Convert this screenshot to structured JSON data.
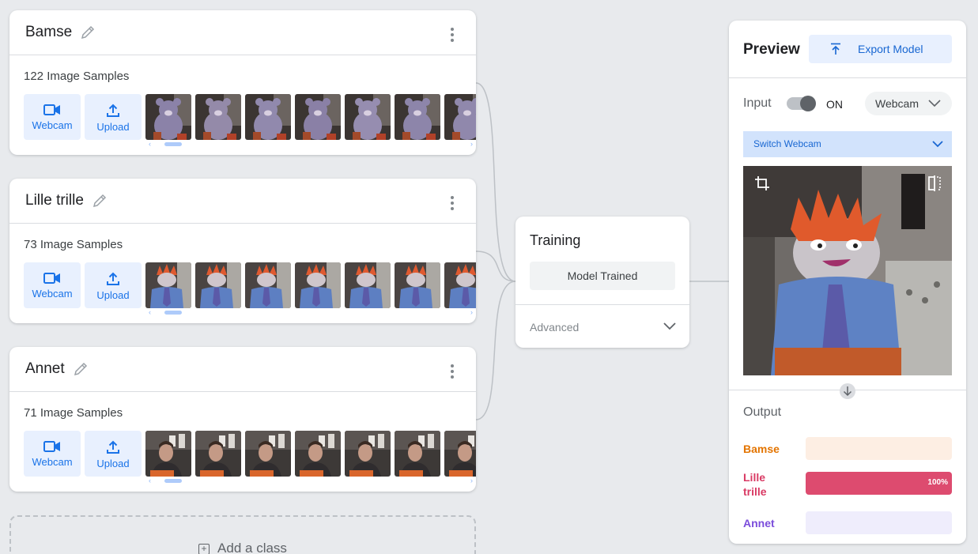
{
  "classes": [
    {
      "name": "Bamse",
      "samples_label": "122 Image Samples",
      "thumb_theme": "bear",
      "scroll_position": 0.04
    },
    {
      "name": "Lille trille",
      "samples_label": "73 Image Samples",
      "thumb_theme": "doll",
      "scroll_position": 0.04
    },
    {
      "name": "Annet",
      "samples_label": "71 Image Samples",
      "thumb_theme": "person",
      "scroll_position": 0.04
    }
  ],
  "sample_buttons": {
    "webcam_label": "Webcam",
    "upload_label": "Upload"
  },
  "add_class_label": "Add a class",
  "training": {
    "title": "Training",
    "button_label": "Model Trained",
    "advanced_label": "Advanced"
  },
  "preview": {
    "title": "Preview",
    "export_label": "Export Model",
    "input_label": "Input",
    "toggle_state": "ON",
    "source_label": "Webcam",
    "switch_label": "Switch Webcam",
    "output_label": "Output",
    "outputs": [
      {
        "label": "Bamse",
        "color": "#e37400",
        "bar_bg": "#fdeee3",
        "fill_color": "#e37400",
        "confidence": 0
      },
      {
        "label": "Lille trille",
        "color": "#d93a64",
        "bar_bg": "#fbe4ea",
        "fill_color": "#dd4b6f",
        "confidence": 1.0,
        "percent_label": "100%"
      },
      {
        "label": "Annet",
        "color": "#7b4ddb",
        "bar_bg": "#efedfc",
        "fill_color": "#7b4ddb",
        "confidence": 0
      }
    ]
  },
  "colors": {
    "accent": "#1a73e8",
    "background": "#e8eaed"
  }
}
